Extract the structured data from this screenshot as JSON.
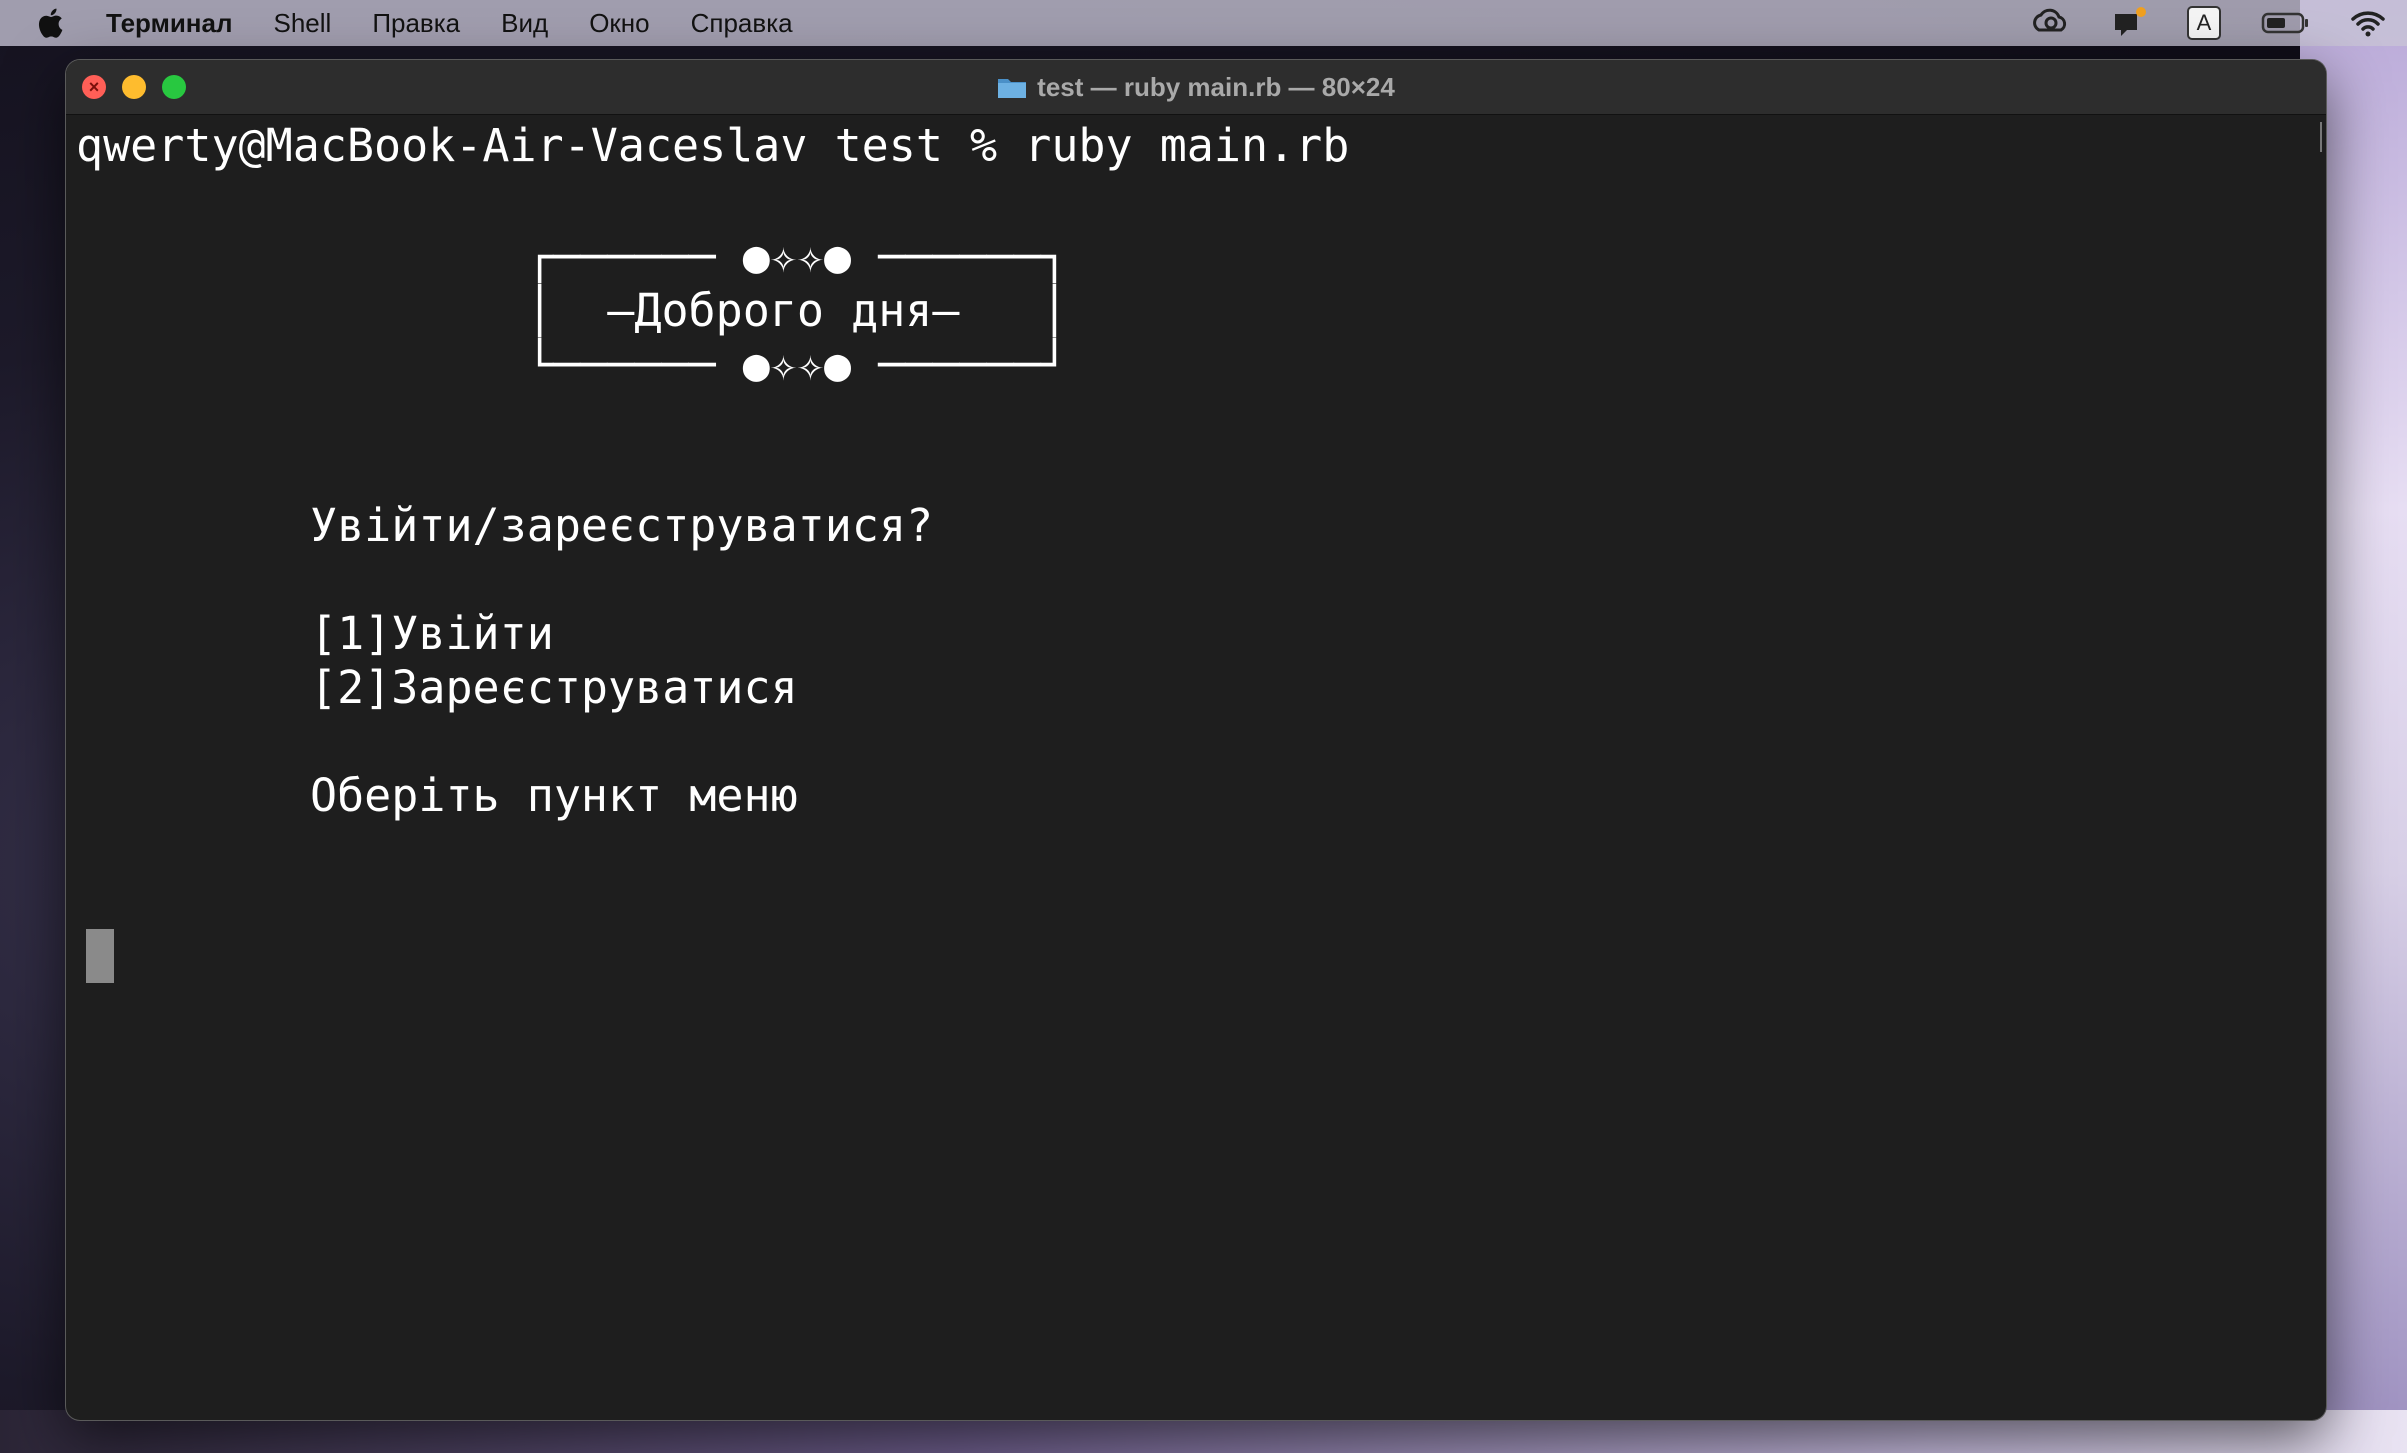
{
  "menubar": {
    "apple": "apple-logo-icon",
    "items": [
      "Терминал",
      "Shell",
      "Правка",
      "Вид",
      "Окно",
      "Справка"
    ],
    "tray": {
      "input_source": "A",
      "icons": [
        "creative-cloud-icon",
        "notification-icon",
        "input-source-icon",
        "battery-icon",
        "wifi-icon"
      ]
    }
  },
  "window": {
    "title": "test — ruby main.rb — 80×24",
    "folder_icon": "folder-icon",
    "traffic_lights": {
      "close": "#ff5f57",
      "minimize": "#febc2e",
      "maximize": "#28c840"
    }
  },
  "terminal": {
    "prompt": "qwerty@MacBook-Air-Vaceslav test % ruby main.rb",
    "banner": {
      "top": "┌────── ●✧✧● ──────┐",
      "middle": "│  –Доброго дня–   │",
      "bottom": "└────── ●✧✧● ──────┘"
    },
    "question": "Увійти/зареєструватися?",
    "options": [
      "[1]Увійти",
      "[2]Зареєструватися"
    ],
    "prompt_text": "Оберіть пункт меню",
    "colors": {
      "background": "#1e1e1e",
      "text": "#ffffff",
      "cursor": "#8a8a8a"
    }
  }
}
